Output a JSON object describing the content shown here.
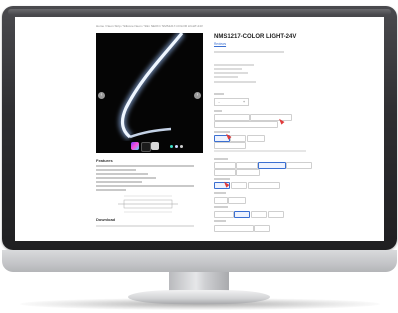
{
  "breadcrumb": "Home / Neon Strip / Silicone Neon / Slim NEON / NMS1217-COLOR LIGHT-24V",
  "product": {
    "title": "NMS1217-COLOR LIGHT-24V",
    "reviews_link": "Reviews"
  },
  "colors": {
    "accent": "#3b6fd1",
    "cursor": "#e03a3a",
    "neon_glow": "#e8f2ff"
  },
  "icons": [
    "prev-arrow-icon",
    "next-arrow-icon",
    "cursor-icon"
  ]
}
